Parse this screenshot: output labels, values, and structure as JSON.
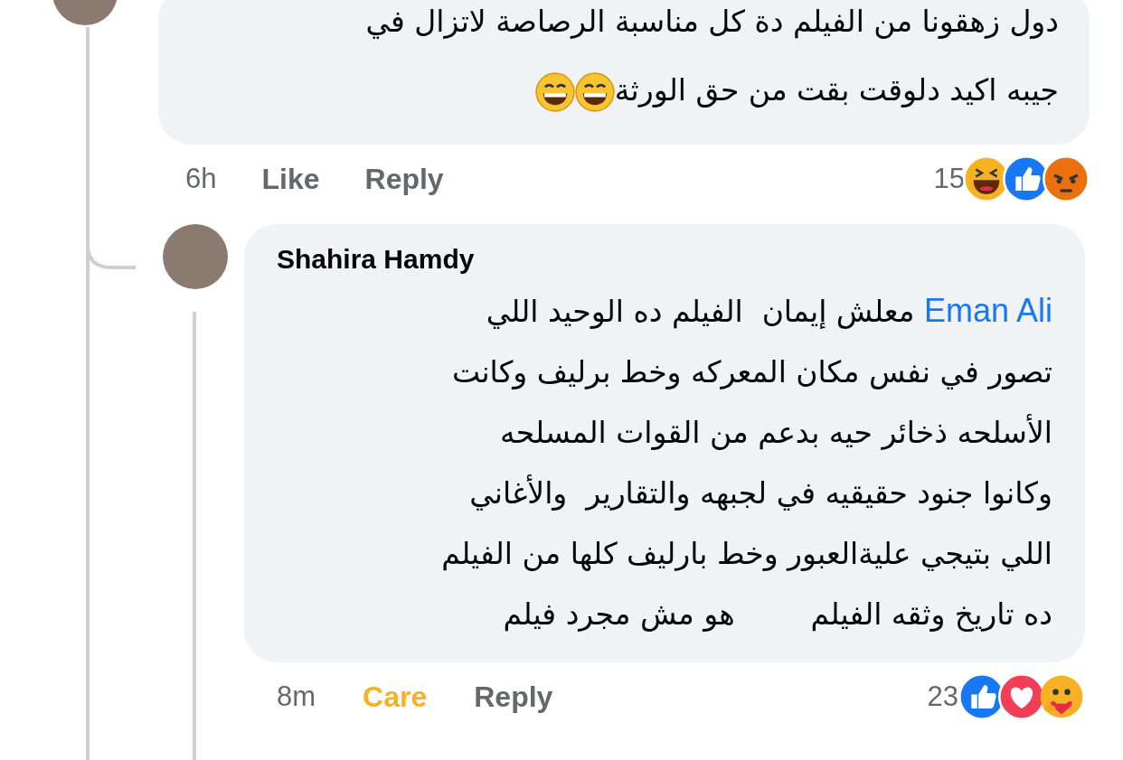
{
  "comments": [
    {
      "lines": [
        "دول زهقونا من الفيلم دة كل مناسبة الرصاصة لاتزال في",
        "جيبه اكيد دلوقت بقت من حق الورثة"
      ],
      "trailing_emoji": [
        {
          "kind": "grin"
        },
        {
          "kind": "grin"
        }
      ],
      "time": "6h",
      "reaction_button": {
        "label": "Like",
        "reacted": false
      },
      "reply_label": "Reply",
      "reaction_count": "15",
      "reactions": [
        {
          "kind": "haha"
        },
        {
          "kind": "like"
        },
        {
          "kind": "angry"
        }
      ]
    },
    {
      "author": "Shahira Hamdy",
      "mention": "Eman Ali",
      "lines": [
        " معلش إيمان  الفيلم ده الوحيد اللي",
        "تصور في نفس مكان المعركه وخط برليف وكانت",
        "الأسلحه ذخائر حيه بدعم من القوات المسلحه",
        "وكانوا جنود حقيقيه في لجبهه والتقارير  والأغاني",
        "اللي بتيجي علية‌العبور وخط بارليف كلها من الفيلم",
        "ده تاريخ وثقه الفيلم        هو مش مجرد فيلم"
      ],
      "time": "8m",
      "reaction_button": {
        "label": "Care",
        "kind": "care",
        "reacted": true
      },
      "reply_label": "Reply",
      "reaction_count": "23",
      "reactions": [
        {
          "kind": "like"
        },
        {
          "kind": "love"
        },
        {
          "kind": "care"
        }
      ]
    }
  ]
}
